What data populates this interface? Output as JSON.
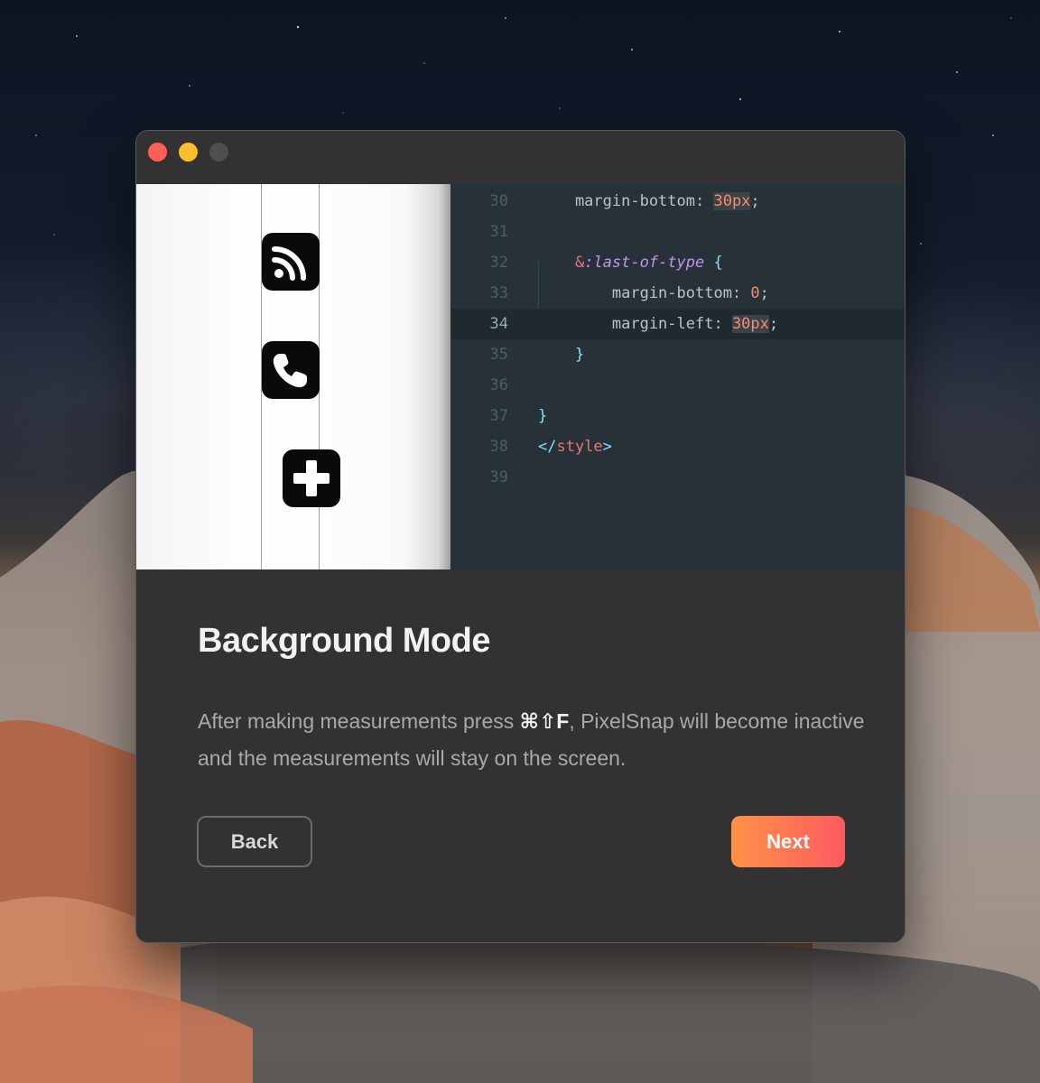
{
  "window": {
    "traffic_lights": [
      "close",
      "minimize",
      "zoom"
    ]
  },
  "preview": {
    "icons": [
      "rss-icon",
      "phone-icon",
      "plus-icon"
    ],
    "code_lines": [
      {
        "num": "30",
        "text": "    margin-bottom: 30px;"
      },
      {
        "num": "31",
        "text": ""
      },
      {
        "num": "32",
        "text": "    &:last-of-type {"
      },
      {
        "num": "33",
        "text": "        margin-bottom: 0;"
      },
      {
        "num": "34",
        "text": "        margin-left: 30px;"
      },
      {
        "num": "35",
        "text": "    }"
      },
      {
        "num": "36",
        "text": ""
      },
      {
        "num": "37",
        "text": "}"
      },
      {
        "num": "38",
        "text": "</style>"
      },
      {
        "num": "39",
        "text": ""
      }
    ],
    "active_line": "34"
  },
  "content": {
    "title": "Background Mode",
    "desc_before": "After making measurements press ",
    "desc_keys": "⌘⇧F",
    "desc_after": ", PixelSnap will become inactive and the measurements will stay on the screen.",
    "back_label": "Back",
    "next_label": "Next"
  },
  "colors": {
    "accent_start": "#ff9248",
    "accent_end": "#ff5a60",
    "window_bg": "#323232",
    "editor_bg": "#263238"
  }
}
